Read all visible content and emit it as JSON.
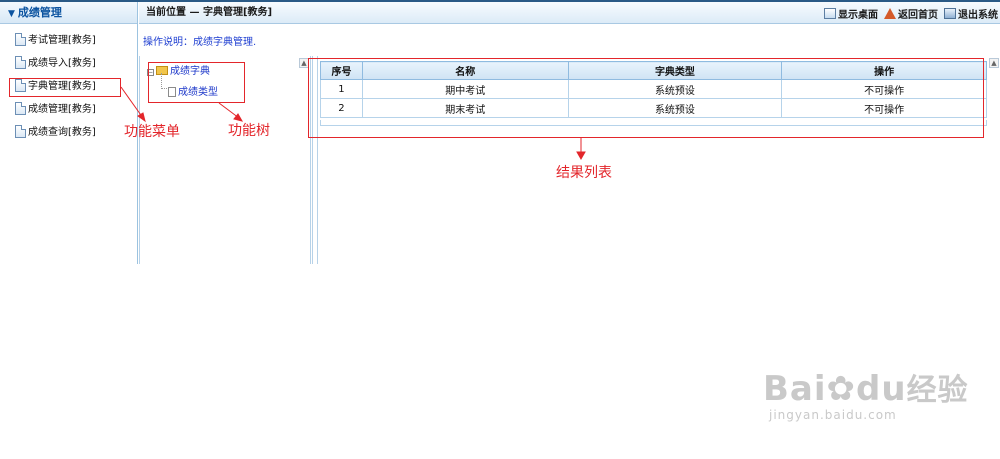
{
  "sidebar": {
    "title": "成绩管理",
    "items": [
      {
        "label": "考试管理[教务]"
      },
      {
        "label": "成绩导入[教务]"
      },
      {
        "label": "字典管理[教务]"
      },
      {
        "label": "成绩管理[教务]"
      },
      {
        "label": "成绩查询[教务]"
      }
    ]
  },
  "header": {
    "breadcrumb": "当前位置 — 字典管理[教务]",
    "actions": [
      {
        "label": "显示桌面",
        "icon": "desktop-icon"
      },
      {
        "label": "返回首页",
        "icon": "home-icon"
      },
      {
        "label": "退出系统",
        "icon": "exit-icon"
      }
    ]
  },
  "hint": "操作说明：成绩字典管理.",
  "tree": {
    "root": "成绩字典",
    "child": "成绩类型",
    "toggle": "−",
    "scroll": "▲"
  },
  "table": {
    "columns": [
      "序号",
      "名称",
      "字典类型",
      "操作"
    ],
    "rows": [
      [
        "1",
        "期中考试",
        "系统预设",
        "不可操作"
      ],
      [
        "2",
        "期末考试",
        "系统预设",
        "不可操作"
      ]
    ]
  },
  "annotations": {
    "menu": "功能菜单",
    "tree": "功能树",
    "results": "结果列表",
    "color": "#e3262b"
  },
  "watermark": {
    "brand_left": "Bai",
    "brand_right": "du",
    "brand_cn": "经验",
    "url": "jingyan.baidu.com"
  },
  "colors": {
    "accent": "#0b53a0",
    "header_bg": "#dcebf7",
    "hint": "#1f3fd1"
  }
}
